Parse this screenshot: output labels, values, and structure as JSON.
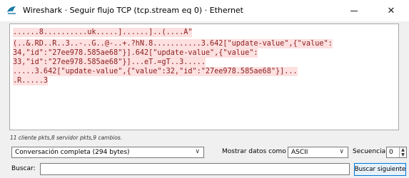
{
  "window": {
    "title": "Wireshark · Seguir flujo TCP (tcp.stream eq 0) · Ethernet",
    "minimize_label": "",
    "close_label": "✕"
  },
  "stream": {
    "lines": [
      {
        "text": "......8..........uk.....]......]..(....A\"",
        "direction": "client"
      },
      {
        "text": "(..&.RD..R..3..-..G..@-..+.?hN.8...........3.642[\"update-value\",{\"value\":",
        "direction": "client"
      },
      {
        "text": "34,\"id\":\"27ee978.585ae68\"}].642[\"update-value\",{\"value\":",
        "direction": "client"
      },
      {
        "text": "33,\"id\":\"27ee978.585ae68\"}]...eT.=gT..3.....",
        "direction": "client"
      },
      {
        "text": ".....3.642[\"update-value\",{\"value\":32,\"id\":\"27ee978.585ae68\"}]...",
        "direction": "client"
      },
      {
        "text": ".R.....3",
        "direction": "client"
      }
    ]
  },
  "summary": "11 cliente pkts,8 servidor pkts,9 cambios.",
  "controls": {
    "conversation_value": "Conversación completa (294 bytes)",
    "show_as_label": "Mostrar datos como",
    "format_value": "ASCII",
    "sequence_label": "Secuencia",
    "sequence_value": "0"
  },
  "search": {
    "label": "Buscar:",
    "value": "",
    "find_next_label": "Buscar siguiente"
  },
  "colors": {
    "client_bg": "#fde0e0",
    "client_fg": "#8b1c1c",
    "button_border": "#0078d7"
  }
}
